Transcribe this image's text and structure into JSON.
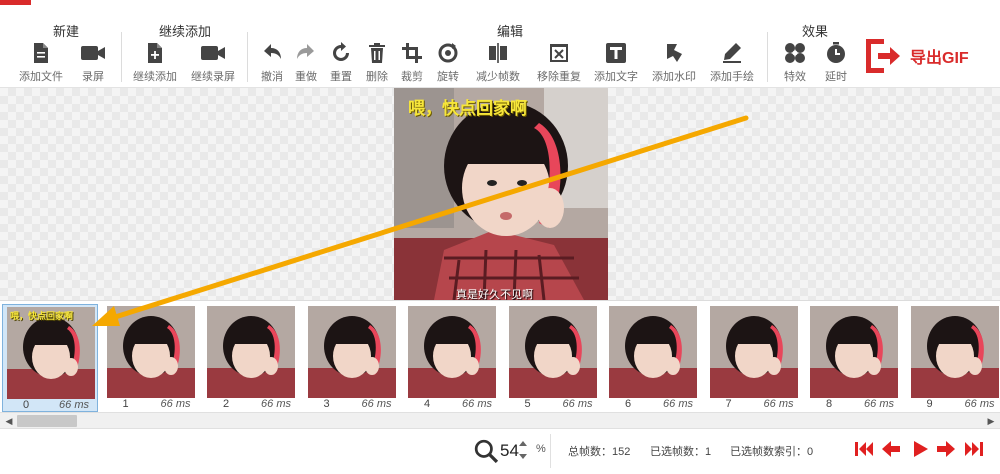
{
  "toolbar": {
    "groups": {
      "new": "新建",
      "continue_add": "继续添加",
      "edit": "编辑",
      "effects": "效果"
    },
    "tools": {
      "add_file": "添加文件",
      "record_screen": "录屏",
      "continue_add": "继续添加",
      "continue_record": "继续录屏",
      "undo": "撤消",
      "redo": "重做",
      "reset": "重置",
      "delete": "删除",
      "crop": "裁剪",
      "rotate": "旋转",
      "reduce_frames": "减少帧数",
      "remove_duplicates": "移除重复",
      "add_text": "添加文字",
      "add_watermark": "添加水印",
      "add_drawing": "添加手绘",
      "effects": "特效",
      "delay": "延时"
    },
    "export_label": "导出GIF"
  },
  "preview": {
    "caption_top": "喂，快点回家啊",
    "caption_bottom": "真是好久不见啊"
  },
  "filmstrip": {
    "thumb_caption": "喂，快点回家啊",
    "frames": [
      {
        "index": "0",
        "duration": "66 ms",
        "selected": true
      },
      {
        "index": "1",
        "duration": "66 ms"
      },
      {
        "index": "2",
        "duration": "66 ms"
      },
      {
        "index": "3",
        "duration": "66 ms"
      },
      {
        "index": "4",
        "duration": "66 ms"
      },
      {
        "index": "5",
        "duration": "66 ms"
      },
      {
        "index": "6",
        "duration": "66 ms"
      },
      {
        "index": "7",
        "duration": "66 ms"
      },
      {
        "index": "8",
        "duration": "66 ms"
      },
      {
        "index": "9",
        "duration": "66 ms"
      }
    ]
  },
  "status": {
    "zoom_value": "54",
    "zoom_unit": "%",
    "total_frames": "总帧数：152",
    "selected_frames": "已选帧数：1",
    "selected_index": "已选帧数索引：0"
  },
  "colors": {
    "accent": "#d92b2b",
    "arrow": "#f5a800",
    "selection": "#d2e6f7"
  },
  "icons": [
    "file-icon",
    "camera-icon",
    "undo-icon",
    "redo-icon",
    "reset-icon",
    "trash-icon",
    "crop-icon",
    "rotate-icon",
    "reduce-frames-icon",
    "remove-duplicates-icon",
    "text-icon",
    "watermark-icon",
    "pen-icon",
    "effects-icon",
    "clock-icon",
    "export-icon",
    "magnifier-icon",
    "first-frame-icon",
    "prev-frame-icon",
    "play-icon",
    "next-frame-icon",
    "last-frame-icon"
  ]
}
